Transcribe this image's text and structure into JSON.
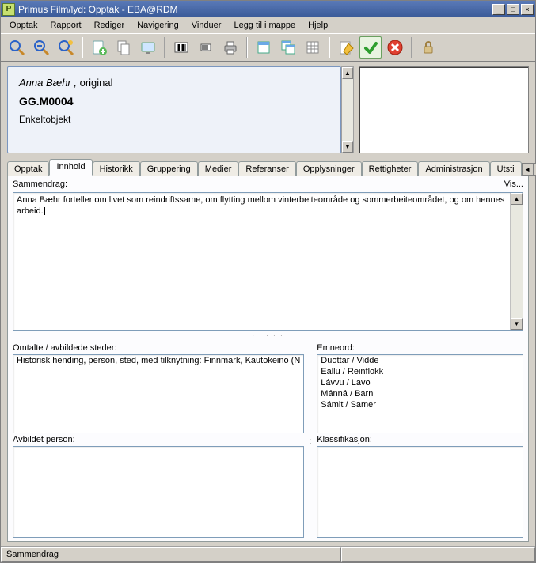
{
  "titlebar": {
    "app_icon_letter": "P",
    "title": "Primus Film/lyd: Opptak - EBA@RDM"
  },
  "window_buttons": {
    "minimize": "_",
    "maximize": "□",
    "close": "×"
  },
  "menubar": [
    "Opptak",
    "Rapport",
    "Rediger",
    "Navigering",
    "Vinduer",
    "Legg til i mappe",
    "Hjelp"
  ],
  "info_panel": {
    "name_primary": "Anna Bæhr ,",
    "name_secondary": "  original",
    "object_id": "GG.M0004",
    "object_type": "Enkeltobjekt"
  },
  "tabs": [
    {
      "label": "Opptak",
      "active": false
    },
    {
      "label": "Innhold",
      "active": true
    },
    {
      "label": "Historikk",
      "active": false
    },
    {
      "label": "Gruppering",
      "active": false
    },
    {
      "label": "Medier",
      "active": false
    },
    {
      "label": "Referanser",
      "active": false
    },
    {
      "label": "Opplysninger",
      "active": false
    },
    {
      "label": "Rettigheter",
      "active": false
    },
    {
      "label": "Administrasjon",
      "active": false
    },
    {
      "label": "Utsti",
      "active": false
    }
  ],
  "sections": {
    "summary_label": "Sammendrag:",
    "summary_vis": "Vis...",
    "summary_text": "Anna Bæhr forteller om livet som reindriftssame, om flytting mellom vinterbeiteområde og sommerbeiteområdet, og om hennes arbeid.",
    "steder_label": "Omtalte / avbildede steder:",
    "steder_items": [
      "Historisk hending, person, sted, med tilknytning: Finnmark, Kautokeino (N"
    ],
    "emneord_label": "Emneord:",
    "emneord_items": [
      "Duottar / Vidde",
      "Eallu / Reinflokk",
      "Lávvu / Lavo",
      "Mánná / Barn",
      "Sámit / Samer"
    ],
    "avbildet_label": "Avbildet person:",
    "klass_label": "Klassifikasjon:"
  },
  "statusbar": {
    "field": "Sammendrag"
  },
  "scroll": {
    "up": "▲",
    "down": "▼",
    "left": "◄",
    "right": "►"
  }
}
